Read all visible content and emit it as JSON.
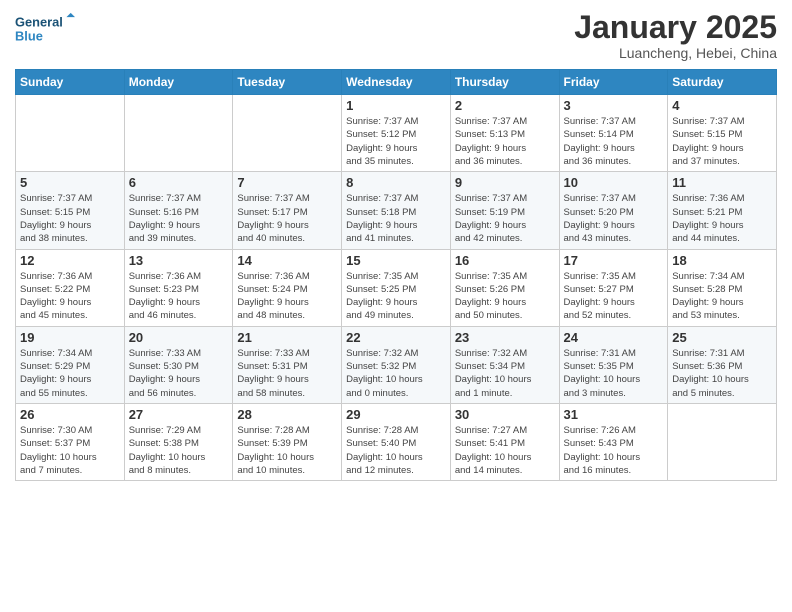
{
  "header": {
    "logo_line1": "General",
    "logo_line2": "Blue",
    "month": "January 2025",
    "location": "Luancheng, Hebei, China"
  },
  "weekdays": [
    "Sunday",
    "Monday",
    "Tuesday",
    "Wednesday",
    "Thursday",
    "Friday",
    "Saturday"
  ],
  "weeks": [
    [
      {
        "day": "",
        "info": ""
      },
      {
        "day": "",
        "info": ""
      },
      {
        "day": "",
        "info": ""
      },
      {
        "day": "1",
        "info": "Sunrise: 7:37 AM\nSunset: 5:12 PM\nDaylight: 9 hours\nand 35 minutes."
      },
      {
        "day": "2",
        "info": "Sunrise: 7:37 AM\nSunset: 5:13 PM\nDaylight: 9 hours\nand 36 minutes."
      },
      {
        "day": "3",
        "info": "Sunrise: 7:37 AM\nSunset: 5:14 PM\nDaylight: 9 hours\nand 36 minutes."
      },
      {
        "day": "4",
        "info": "Sunrise: 7:37 AM\nSunset: 5:15 PM\nDaylight: 9 hours\nand 37 minutes."
      }
    ],
    [
      {
        "day": "5",
        "info": "Sunrise: 7:37 AM\nSunset: 5:15 PM\nDaylight: 9 hours\nand 38 minutes."
      },
      {
        "day": "6",
        "info": "Sunrise: 7:37 AM\nSunset: 5:16 PM\nDaylight: 9 hours\nand 39 minutes."
      },
      {
        "day": "7",
        "info": "Sunrise: 7:37 AM\nSunset: 5:17 PM\nDaylight: 9 hours\nand 40 minutes."
      },
      {
        "day": "8",
        "info": "Sunrise: 7:37 AM\nSunset: 5:18 PM\nDaylight: 9 hours\nand 41 minutes."
      },
      {
        "day": "9",
        "info": "Sunrise: 7:37 AM\nSunset: 5:19 PM\nDaylight: 9 hours\nand 42 minutes."
      },
      {
        "day": "10",
        "info": "Sunrise: 7:37 AM\nSunset: 5:20 PM\nDaylight: 9 hours\nand 43 minutes."
      },
      {
        "day": "11",
        "info": "Sunrise: 7:36 AM\nSunset: 5:21 PM\nDaylight: 9 hours\nand 44 minutes."
      }
    ],
    [
      {
        "day": "12",
        "info": "Sunrise: 7:36 AM\nSunset: 5:22 PM\nDaylight: 9 hours\nand 45 minutes."
      },
      {
        "day": "13",
        "info": "Sunrise: 7:36 AM\nSunset: 5:23 PM\nDaylight: 9 hours\nand 46 minutes."
      },
      {
        "day": "14",
        "info": "Sunrise: 7:36 AM\nSunset: 5:24 PM\nDaylight: 9 hours\nand 48 minutes."
      },
      {
        "day": "15",
        "info": "Sunrise: 7:35 AM\nSunset: 5:25 PM\nDaylight: 9 hours\nand 49 minutes."
      },
      {
        "day": "16",
        "info": "Sunrise: 7:35 AM\nSunset: 5:26 PM\nDaylight: 9 hours\nand 50 minutes."
      },
      {
        "day": "17",
        "info": "Sunrise: 7:35 AM\nSunset: 5:27 PM\nDaylight: 9 hours\nand 52 minutes."
      },
      {
        "day": "18",
        "info": "Sunrise: 7:34 AM\nSunset: 5:28 PM\nDaylight: 9 hours\nand 53 minutes."
      }
    ],
    [
      {
        "day": "19",
        "info": "Sunrise: 7:34 AM\nSunset: 5:29 PM\nDaylight: 9 hours\nand 55 minutes."
      },
      {
        "day": "20",
        "info": "Sunrise: 7:33 AM\nSunset: 5:30 PM\nDaylight: 9 hours\nand 56 minutes."
      },
      {
        "day": "21",
        "info": "Sunrise: 7:33 AM\nSunset: 5:31 PM\nDaylight: 9 hours\nand 58 minutes."
      },
      {
        "day": "22",
        "info": "Sunrise: 7:32 AM\nSunset: 5:32 PM\nDaylight: 10 hours\nand 0 minutes."
      },
      {
        "day": "23",
        "info": "Sunrise: 7:32 AM\nSunset: 5:34 PM\nDaylight: 10 hours\nand 1 minute."
      },
      {
        "day": "24",
        "info": "Sunrise: 7:31 AM\nSunset: 5:35 PM\nDaylight: 10 hours\nand 3 minutes."
      },
      {
        "day": "25",
        "info": "Sunrise: 7:31 AM\nSunset: 5:36 PM\nDaylight: 10 hours\nand 5 minutes."
      }
    ],
    [
      {
        "day": "26",
        "info": "Sunrise: 7:30 AM\nSunset: 5:37 PM\nDaylight: 10 hours\nand 7 minutes."
      },
      {
        "day": "27",
        "info": "Sunrise: 7:29 AM\nSunset: 5:38 PM\nDaylight: 10 hours\nand 8 minutes."
      },
      {
        "day": "28",
        "info": "Sunrise: 7:28 AM\nSunset: 5:39 PM\nDaylight: 10 hours\nand 10 minutes."
      },
      {
        "day": "29",
        "info": "Sunrise: 7:28 AM\nSunset: 5:40 PM\nDaylight: 10 hours\nand 12 minutes."
      },
      {
        "day": "30",
        "info": "Sunrise: 7:27 AM\nSunset: 5:41 PM\nDaylight: 10 hours\nand 14 minutes."
      },
      {
        "day": "31",
        "info": "Sunrise: 7:26 AM\nSunset: 5:43 PM\nDaylight: 10 hours\nand 16 minutes."
      },
      {
        "day": "",
        "info": ""
      }
    ]
  ]
}
